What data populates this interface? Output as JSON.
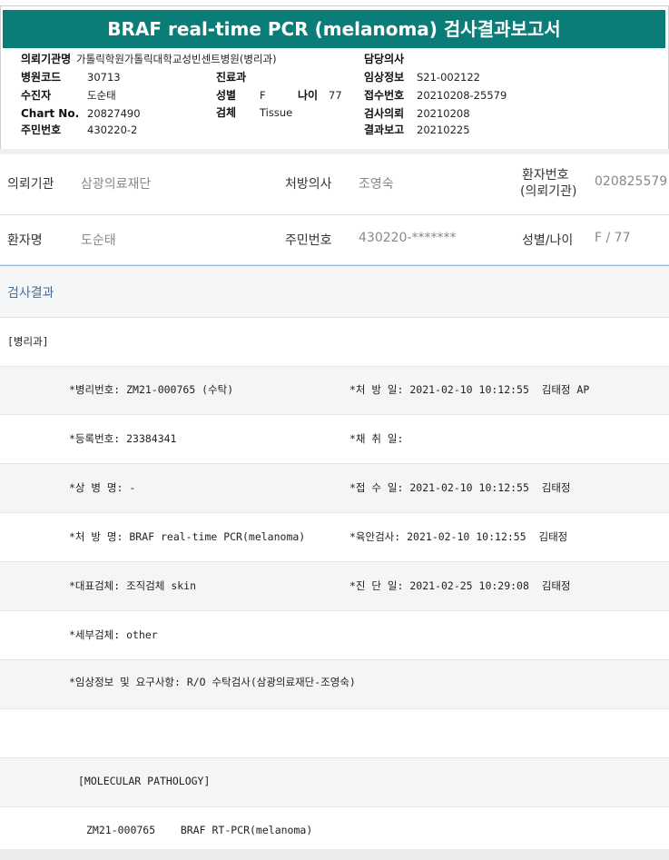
{
  "report": {
    "title": "BRAF real-time PCR (melanoma) 검사결과보고서",
    "fields": {
      "institution_label": "의뢰기관명",
      "institution_value": "가톨릭학원가톨릭대학교성빈센트병원(병리과)",
      "hospital_code_label": "병원코드",
      "hospital_code_value": "30713",
      "patient_label": "수진자",
      "patient_value": "도순태",
      "chart_label": "Chart No.",
      "chart_value": "20827490",
      "resident_label": "주민번호",
      "resident_value": "430220-2",
      "dept_label": "진료과",
      "sex_label": "성별",
      "sex_value": "F",
      "age_label": "나이",
      "age_value": "77",
      "specimen_label": "검체",
      "specimen_value": "Tissue",
      "doctor_label": "담당의사",
      "clinical_label": "임상정보",
      "clinical_value": "S21-002122",
      "receipt_label": "접수번호",
      "receipt_value": "20210208-25579",
      "request_label": "검사의뢰",
      "request_value": "20210208",
      "report_label": "결과보고",
      "report_value": "20210225"
    }
  },
  "info": {
    "row1": {
      "inst_label": "의뢰기관",
      "inst_value": "삼광의료재단",
      "doctor_label": "처방의사",
      "doctor_value": "조영숙",
      "patno_label_1": "환자번호",
      "patno_label_2": "(의뢰기관)",
      "patno_value": "020825579"
    },
    "row2": {
      "name_label": "환자명",
      "name_value": "도순태",
      "resident_label": "주민번호",
      "resident_value": "430220-*******",
      "sexage_label": "성별/나이",
      "sexage_value": "F / 77"
    }
  },
  "result": {
    "section_title": "검사결과",
    "dept": "[병리과]",
    "lines": [
      {
        "left": "*병리번호: ZM21-000765 (수탁)",
        "right": "*처 방 일: 2021-02-10 10:12:55  김태정 AP"
      },
      {
        "left": "*등록번호: 23384341",
        "right": "*채 취 일:"
      },
      {
        "left": "*상 병 명: -",
        "right": "*접 수 일: 2021-02-10 10:12:55  김태정"
      },
      {
        "left": "*처 방 명: BRAF real-time PCR(melanoma)",
        "right": "*육안검사: 2021-02-10 10:12:55  김태정"
      },
      {
        "left": "*대표검체: 조직검체 skin",
        "right": "*진 단 일: 2021-02-25 10:29:08  김태정"
      },
      {
        "left": "*세부검체: other",
        "right": ""
      },
      {
        "left": "*임상정보 및 요구사항: R/O 수탁검사(삼광의료재단-조영숙)",
        "right": ""
      }
    ],
    "mol_header": "[MOLECULAR PATHOLOGY]",
    "mol_line": "ZM21-000765    BRAF RT-PCR(melanoma)"
  }
}
